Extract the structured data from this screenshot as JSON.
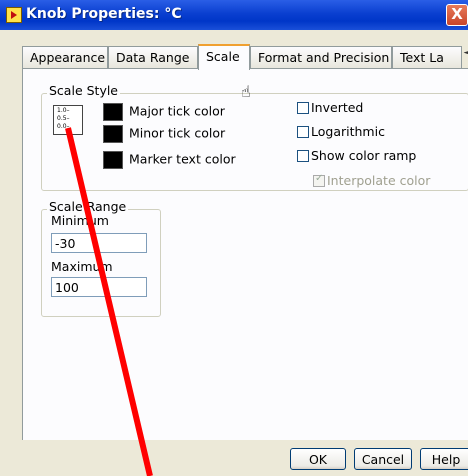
{
  "window": {
    "title": "Knob Properties: °C",
    "close_label": "X"
  },
  "tabs": [
    {
      "label": "Appearance",
      "active": false
    },
    {
      "label": "Data Range",
      "active": false
    },
    {
      "label": "Scale",
      "active": true
    },
    {
      "label": "Format and Precision",
      "active": false
    },
    {
      "label": "Text La",
      "active": false
    }
  ],
  "tab_scroll": {
    "left": "◄",
    "right": "►"
  },
  "scale_style": {
    "legend": "Scale Style",
    "icon_ticks": [
      "1.0–",
      "0.5–",
      "0.0–"
    ],
    "colors": [
      {
        "label": "Major tick color",
        "value": "#000000"
      },
      {
        "label": "Minor tick color",
        "value": "#000000"
      },
      {
        "label": "Marker text color",
        "value": "#000000"
      }
    ],
    "options": [
      {
        "label": "Inverted",
        "checked": false,
        "disabled": false
      },
      {
        "label": "Logarithmic",
        "checked": false,
        "disabled": false
      },
      {
        "label": "Show color ramp",
        "checked": false,
        "disabled": false
      },
      {
        "label": "Interpolate color",
        "checked": true,
        "disabled": true
      }
    ]
  },
  "scale_range": {
    "legend": "Scale Range",
    "minimum_label": "Minimum",
    "minimum_value": "-30",
    "maximum_label": "Maximum",
    "maximum_value": "100"
  },
  "buttons": {
    "ok": "OK",
    "cancel": "Cancel",
    "help": "Help"
  },
  "cursor": "hand-pointer-icon",
  "annotation_color": "#ff0000"
}
